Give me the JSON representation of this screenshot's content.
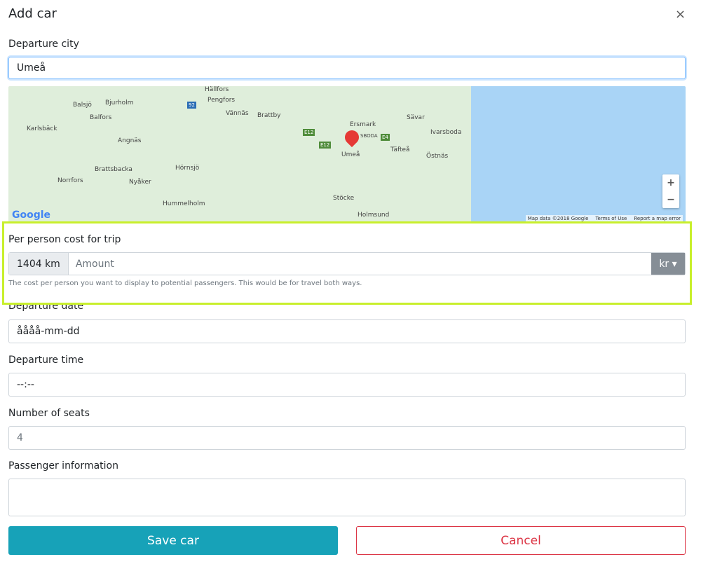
{
  "modal": {
    "title": "Add car",
    "close": "×"
  },
  "departure_city": {
    "label": "Departure city",
    "value": "Umeå"
  },
  "map": {
    "towns": [
      "Hällfors",
      "Balsjö",
      "Bjurholm",
      "Pengfors",
      "Vännäs",
      "Brattby",
      "Balfors",
      "Karlsbäck",
      "Angnäs",
      "Ersmark",
      "Sävar",
      "Ivarsboda",
      "Umeå",
      "Täfteå",
      "Östnäs",
      "Brattsbacka",
      "Hörnsjö",
      "Norrfors",
      "Nyåker",
      "Hummelholm",
      "Stöcke",
      "Holmsund",
      "SBODA"
    ],
    "road_shields": [
      "92",
      "E12",
      "E12",
      "E4"
    ],
    "logo": "Google",
    "zoom_in": "+",
    "zoom_out": "−",
    "attribution": [
      "Map data ©2018 Google",
      "Terms of Use",
      "Report a map error"
    ]
  },
  "cost": {
    "label": "Per person cost for trip",
    "distance": "1404 km",
    "amount_placeholder": "Amount",
    "currency": "kr ▾",
    "help": "The cost per person you want to display to potential passengers. This would be for travel both ways.",
    "highlight_color": "#c8ef2c"
  },
  "departure_date": {
    "label": "Departure date",
    "value": "åååå-mm-dd"
  },
  "departure_time": {
    "label": "Departure time",
    "value": "--:--"
  },
  "seats": {
    "label": "Number of seats",
    "value": "4"
  },
  "passenger_info": {
    "label": "Passenger information",
    "value": ""
  },
  "buttons": {
    "save": "Save car",
    "cancel": "Cancel"
  }
}
